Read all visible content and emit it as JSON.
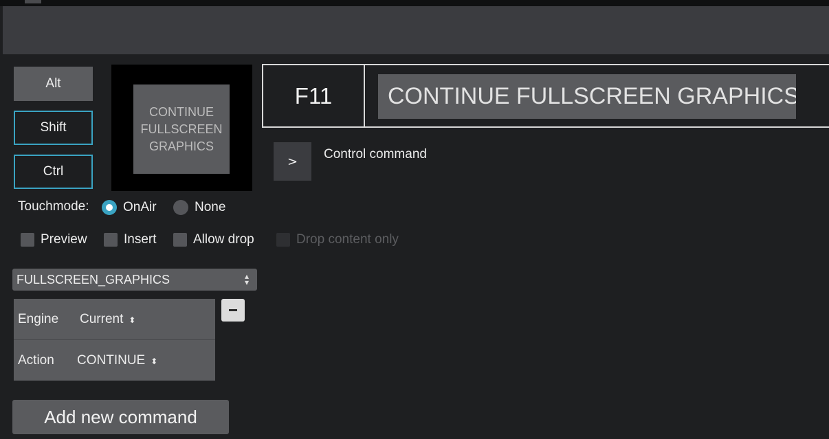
{
  "modifiers": {
    "alt": "Alt",
    "shift": "Shift",
    "ctrl": "Ctrl"
  },
  "preview": {
    "line1": "CONTINUE",
    "line2": "FULLSCREEN",
    "line3": "GRAPHICS"
  },
  "hotkey": {
    "key": "F11",
    "title": "CONTINUE FULLSCREEN GRAPHICS"
  },
  "control_command": {
    "toggle": ">",
    "label": "Control command"
  },
  "touchmode": {
    "label": "Touchmode:",
    "options": [
      {
        "label": "OnAir",
        "selected": true
      },
      {
        "label": "None",
        "selected": false
      }
    ]
  },
  "options": [
    {
      "label": "Preview",
      "checked": false,
      "enabled": true
    },
    {
      "label": "Insert",
      "checked": false,
      "enabled": true
    },
    {
      "label": "Allow drop",
      "checked": false,
      "enabled": true
    },
    {
      "label": "Drop content only",
      "checked": false,
      "enabled": false
    }
  ],
  "command": {
    "type": "FULLSCREEN_GRAPHICS",
    "params": [
      {
        "name": "Engine",
        "value": "Current"
      },
      {
        "name": "Action",
        "value": "CONTINUE"
      }
    ],
    "remove_icon": "minus-icon",
    "select_arrows_icon": "updown-arrows-icon"
  },
  "add_button": "Add new command",
  "colors": {
    "accent": "#3aa3c2",
    "background": "#1e1f21",
    "panel": "#5a5b5e",
    "header": "#3b3c40"
  }
}
